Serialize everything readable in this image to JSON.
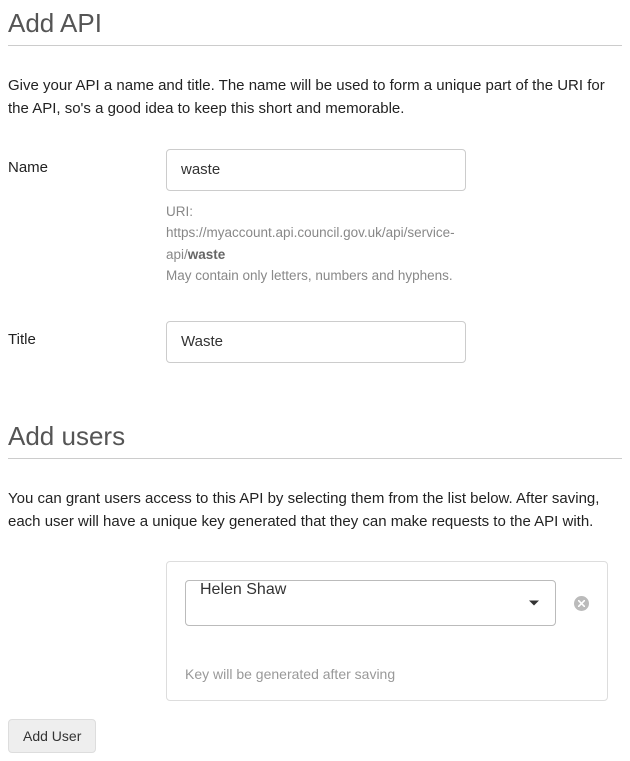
{
  "section_api": {
    "title": "Add API",
    "help": "Give your API a name and title. The name will be used to form a unique part of the URI for the API, so's a good idea to keep this short and memorable.",
    "name": {
      "label": "Name",
      "value": "waste",
      "uri_prefix": "URI: https://myaccount.api.council.gov.uk/api/service-api/",
      "uri_suffix": "waste",
      "rules": "May contain only letters, numbers and hyphens."
    },
    "title_field": {
      "label": "Title",
      "value": "Waste"
    }
  },
  "section_users": {
    "title": "Add users",
    "help": "You can grant users access to this API by selecting them from the list below. After saving, each user will have a unique key generated that they can make requests to the API with.",
    "user_card": {
      "selected": "Helen Shaw",
      "note": "Key will be generated after saving"
    },
    "add_button": "Add User"
  }
}
